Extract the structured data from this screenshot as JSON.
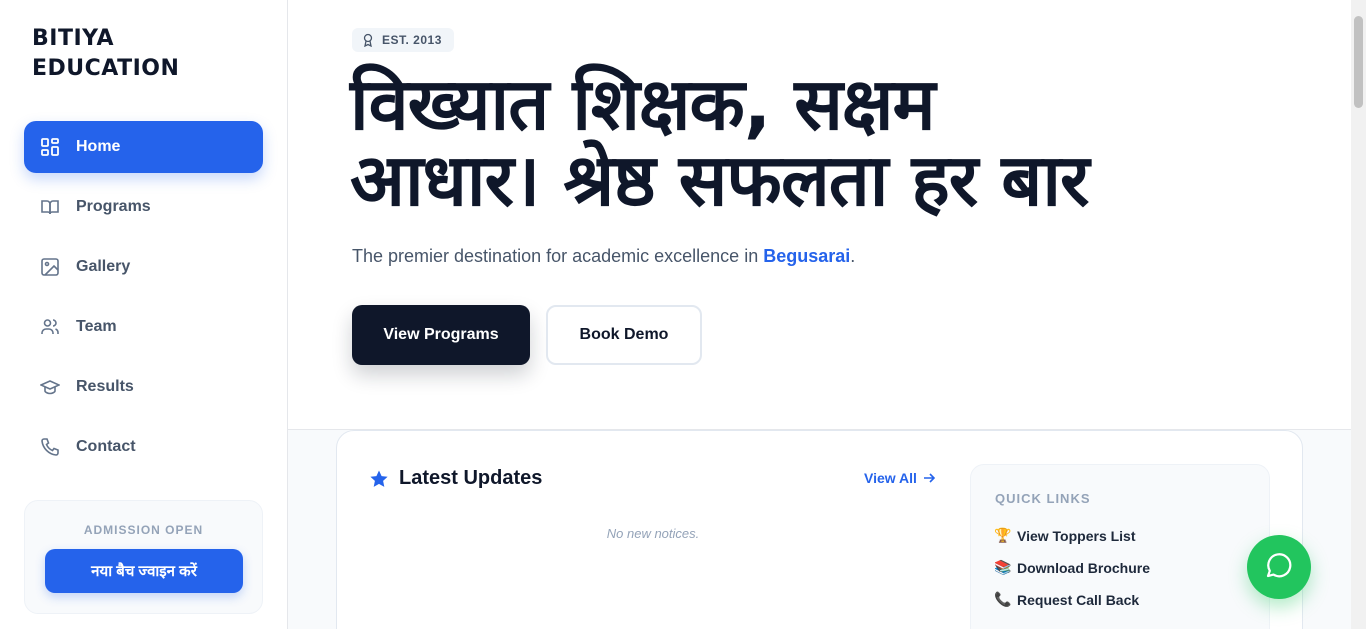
{
  "brand": {
    "line1": "BITIYA",
    "line2": "EDUCATION"
  },
  "sidebar": {
    "items": [
      {
        "label": "Home",
        "icon": "grid-icon",
        "active": true
      },
      {
        "label": "Programs",
        "icon": "book-icon"
      },
      {
        "label": "Gallery",
        "icon": "image-icon"
      },
      {
        "label": "Team",
        "icon": "users-icon"
      },
      {
        "label": "Results",
        "icon": "graduation-cap-icon"
      },
      {
        "label": "Contact",
        "icon": "phone-icon"
      }
    ],
    "admission": {
      "label": "ADMISSION OPEN",
      "button": "नया बैच ज्वाइन करें"
    }
  },
  "hero": {
    "badge": "EST. 2013",
    "headline_line1": "विख्यात शिक्षक, सक्षम",
    "headline_line2": "आधार। श्रेष्ठ सफलता हर बार",
    "subline_prefix": "The premier destination for academic excellence in ",
    "subline_highlight": "Begusarai",
    "subline_suffix": ".",
    "primary_button": "View Programs",
    "secondary_button": "Book Demo"
  },
  "updates": {
    "title": "Latest Updates",
    "view_all": "View All",
    "empty": "No new notices."
  },
  "quick_links": {
    "label": "QUICK LINKS",
    "items": [
      {
        "label": "View Toppers List",
        "icon": "trophy-icon",
        "glyph": "🏆"
      },
      {
        "label": "Download Brochure",
        "icon": "books-icon",
        "glyph": "📚"
      },
      {
        "label": "Request Call Back",
        "icon": "telephone-icon",
        "glyph": "📞"
      }
    ]
  },
  "colors": {
    "accent": "#2563eb",
    "dark": "#0f172a",
    "whatsapp": "#22c55e"
  }
}
